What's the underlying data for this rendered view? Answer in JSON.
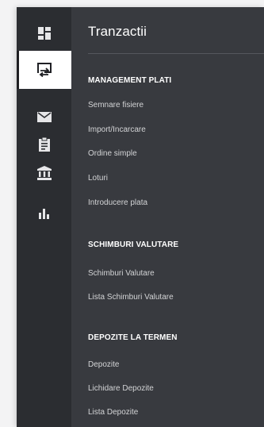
{
  "colors": {
    "rail_bg": "#2b2d31",
    "panel_bg": "#383a3f",
    "active_bg": "#ffffff",
    "link_text": "#d3d4d6",
    "heading_text": "#ffffff"
  },
  "rail": {
    "items": [
      {
        "icon": "dashboard-icon",
        "active": false
      },
      {
        "icon": "transfer-icon",
        "active": true
      },
      {
        "icon": "mail-icon",
        "active": false
      },
      {
        "icon": "clipboard-icon",
        "active": false
      },
      {
        "icon": "bank-icon",
        "active": false
      },
      {
        "icon": "bar-chart-icon",
        "active": false
      }
    ]
  },
  "panel": {
    "title": "Tranzactii",
    "sections": [
      {
        "title": "MANAGEMENT PLATI",
        "items": [
          "Semnare fisiere",
          "Import/Incarcare",
          "Ordine simple",
          "Loturi",
          "Introducere plata"
        ]
      },
      {
        "title": "SCHIMBURI VALUTARE",
        "items": [
          "Schimburi Valutare",
          "Lista Schimburi Valutare"
        ]
      },
      {
        "title": "DEPOZITE LA TERMEN",
        "items": [
          "Depozite",
          "Lichidare Depozite",
          "Lista Depozite"
        ]
      }
    ]
  }
}
